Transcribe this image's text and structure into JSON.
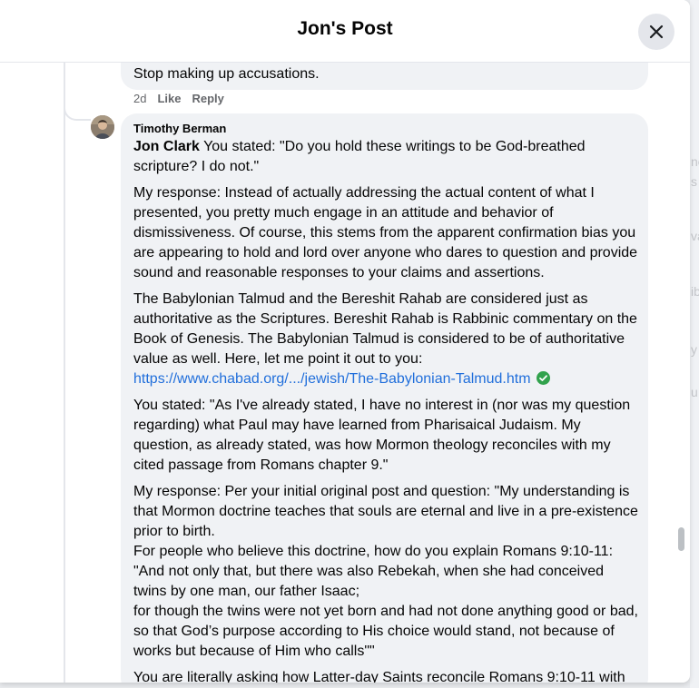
{
  "dialog": {
    "title": "Jon's Post"
  },
  "previous_comment": {
    "text": "Stop making up accusations.",
    "timestamp": "2d",
    "like_label": "Like",
    "reply_label": "Reply"
  },
  "comment": {
    "author": "Timothy Berman",
    "mention": "Jon Clark",
    "p1_rest": " You stated: \"Do you hold these writings to be God-breathed scripture? I do not.\"",
    "p2": "My response: Instead of actually addressing the actual content of what I presented, you pretty much engage in an attitude and behavior of dismissiveness. Of course, this stems from the apparent confirmation bias you are appearing to hold and lord over anyone who dares to question and provide sound and reasonable responses to your claims and assertions.",
    "p3": "The Babylonian Talmud and the Bereshit Rahab are considered just as authoritative as the Scriptures. Bereshit Rahab is Rabbinic commentary on the Book of Genesis. The Babylonian Talmud is considered to be of authoritative value as well. Here, let me point it out to you:",
    "link": "https://www.chabad.org/.../jewish/The-Babylonian-Talmud.htm",
    "p4": "You stated: \"As I've already stated, I have no interest in (nor was my question regarding) what Paul may have learned from Pharisaical Judaism. My question, as already stated, was how Mormon theology reconciles with my cited passage from Romans chapter 9.\"",
    "p5_lines": [
      "My response: Per your initial original post and question: \"My understanding is that Mormon doctrine teaches that souls are eternal and live in a pre-existence prior to birth.",
      "For people who believe this doctrine, how do you explain Romans 9:10-11:",
      "\"And not only that, but there was also Rebekah, when she had conceived twins by one man, our father Isaac;",
      "for though the twins were not yet born and had not done anything good or bad, so that God’s purpose according to His choice would stand, not because of works but because of Him who calls\"\""
    ],
    "p6_partial": "You are literally asking how Latter-day Saints reconcile Romans 9:10-11 with"
  },
  "colors": {
    "bubble": "#f0f2f5",
    "link": "#216fdb",
    "verified": "#31a24c",
    "secondary_text": "#65676b"
  },
  "icons": {
    "close": "close-icon",
    "verified": "verified-check-icon"
  }
}
